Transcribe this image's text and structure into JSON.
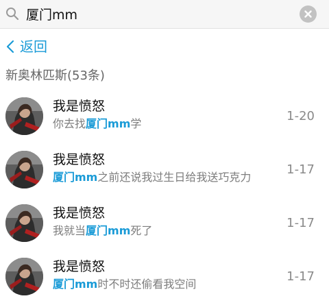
{
  "search": {
    "query": "厦门mm",
    "icon": "search-icon",
    "clear_icon": "clear-icon"
  },
  "back": {
    "label": "返回",
    "icon": "chevron-left-icon"
  },
  "section": {
    "header": "新奥林匹斯(53条)"
  },
  "colors": {
    "accent": "#1a9bd7",
    "secondary_text": "#7d7d7d",
    "primary_text": "#111111"
  },
  "results": [
    {
      "name": "我是愤怒",
      "snippet": {
        "before": "你去找",
        "highlight": "厦门mm",
        "after": "学"
      },
      "date": "1-20"
    },
    {
      "name": "我是愤怒",
      "snippet": {
        "before": "",
        "highlight": "厦门mm",
        "after": "之前还说我过生日给我送巧克力"
      },
      "date": "1-17"
    },
    {
      "name": "我是愤怒",
      "snippet": {
        "before": "我就当",
        "highlight": "厦门mm",
        "after": "死了"
      },
      "date": "1-17"
    },
    {
      "name": "我是愤怒",
      "snippet": {
        "before": "",
        "highlight": "厦门mm",
        "after": "时不时还偷看我空间"
      },
      "date": "1-17"
    }
  ]
}
